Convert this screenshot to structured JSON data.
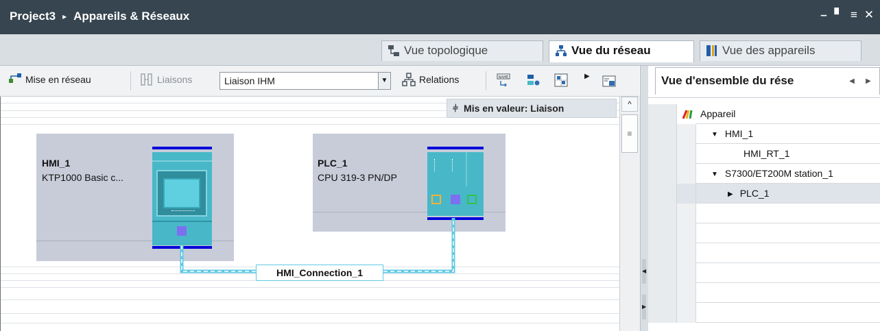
{
  "window": {
    "title_project": "Project3",
    "title_section": "Appareils & Réseaux",
    "separator": "▸"
  },
  "views": {
    "topology": "Vue topologique",
    "network": "Vue du réseau",
    "devices": "Vue des appareils"
  },
  "toolbar": {
    "networking": "Mise en réseau",
    "connections": "Liaisons",
    "connection_type": "Liaison IHM",
    "relations": "Relations"
  },
  "canvas": {
    "highlight_tip": "Mis en valeur: Liaison",
    "devices": [
      {
        "name": "HMI_1",
        "type": "KTP1000 Basic c..."
      },
      {
        "name": "PLC_1",
        "type": "CPU 319-3 PN/DP"
      }
    ],
    "connection_label": "HMI_Connection_1"
  },
  "overview": {
    "tab_label": "Vue d'ensemble du rése",
    "column_header": "Appareil",
    "rows": [
      {
        "label": "HMI_1",
        "indent": 1,
        "expander": "▼"
      },
      {
        "label": "HMI_RT_1",
        "indent": 2,
        "expander": ""
      },
      {
        "label": "S7300/ET200M station_1",
        "indent": 1,
        "expander": "▼"
      },
      {
        "label": "PLC_1",
        "indent": 2,
        "expander": "▶"
      }
    ]
  },
  "colors": {
    "titlebar": "#36454f",
    "device_box": "#c8ccd9",
    "device_body": "#48b8c8",
    "rail": "#0000d8",
    "connection": "#5fc9e3"
  }
}
